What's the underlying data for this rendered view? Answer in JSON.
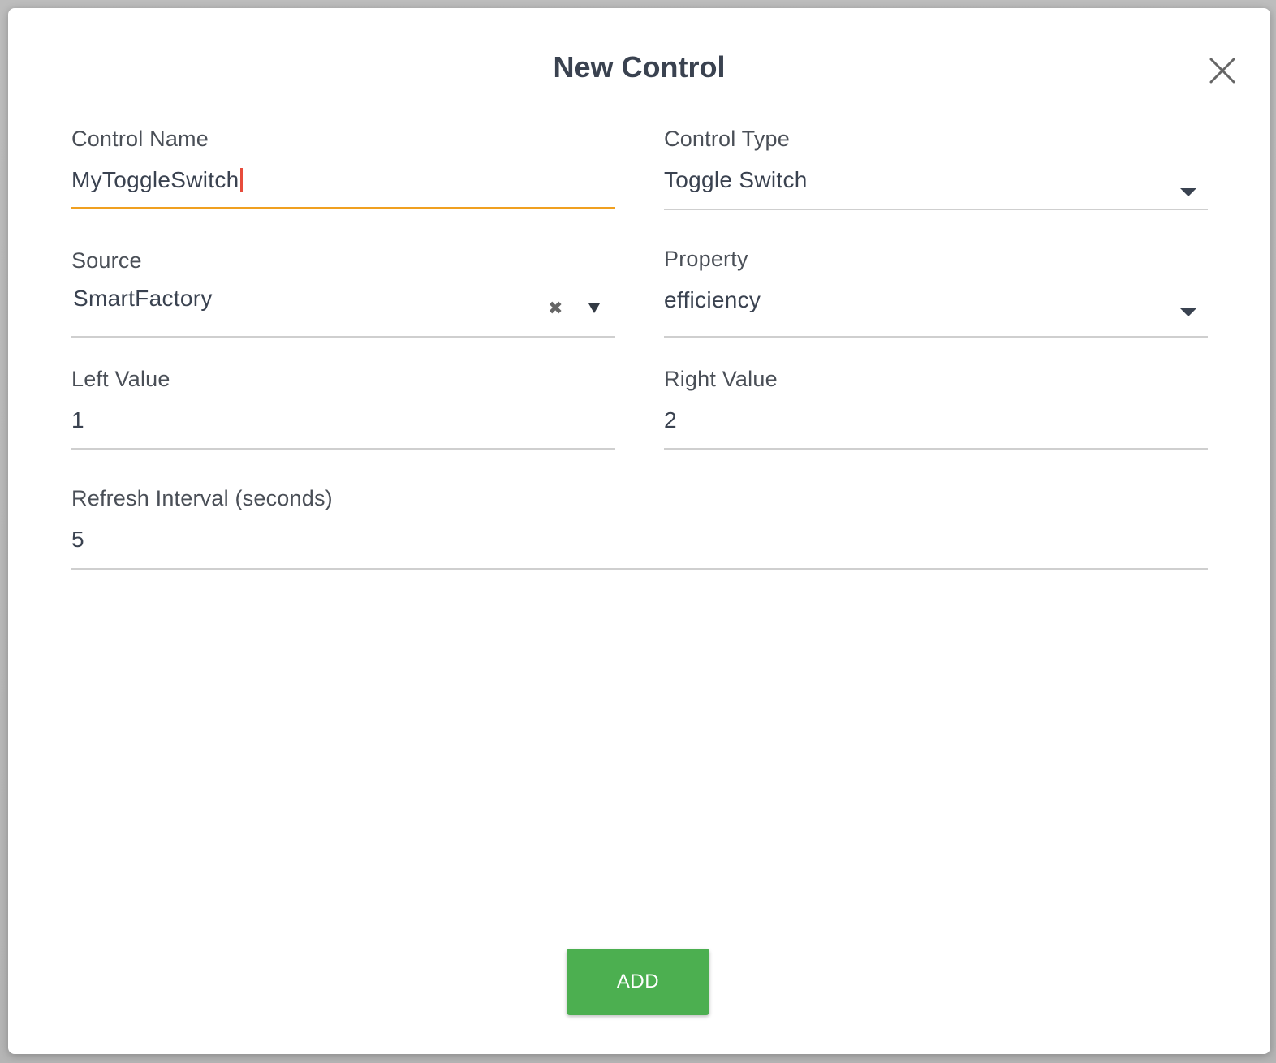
{
  "dialog": {
    "title": "New Control",
    "close_icon": "close-icon"
  },
  "fields": {
    "control_name": {
      "label": "Control Name",
      "value": "MyToggleSwitch",
      "focused": true
    },
    "control_type": {
      "label": "Control Type",
      "value": "Toggle Switch",
      "icon": "chevron-down-icon"
    },
    "source": {
      "label": "Source",
      "value": "SmartFactory",
      "clear_icon": "clear-icon",
      "clear_glyph": "✖",
      "icon": "caret-down-icon"
    },
    "property": {
      "label": "Property",
      "value": "efficiency",
      "icon": "chevron-down-icon"
    },
    "left_value": {
      "label": "Left Value",
      "value": "1"
    },
    "right_value": {
      "label": "Right Value",
      "value": "2"
    },
    "refresh_interval": {
      "label": "Refresh Interval (seconds)",
      "value": "5"
    }
  },
  "actions": {
    "add_label": "ADD"
  },
  "colors": {
    "accent_underline": "#f0a020",
    "caret": "#e74c3c",
    "add_button": "#4caf50",
    "text": "#3a4250"
  }
}
